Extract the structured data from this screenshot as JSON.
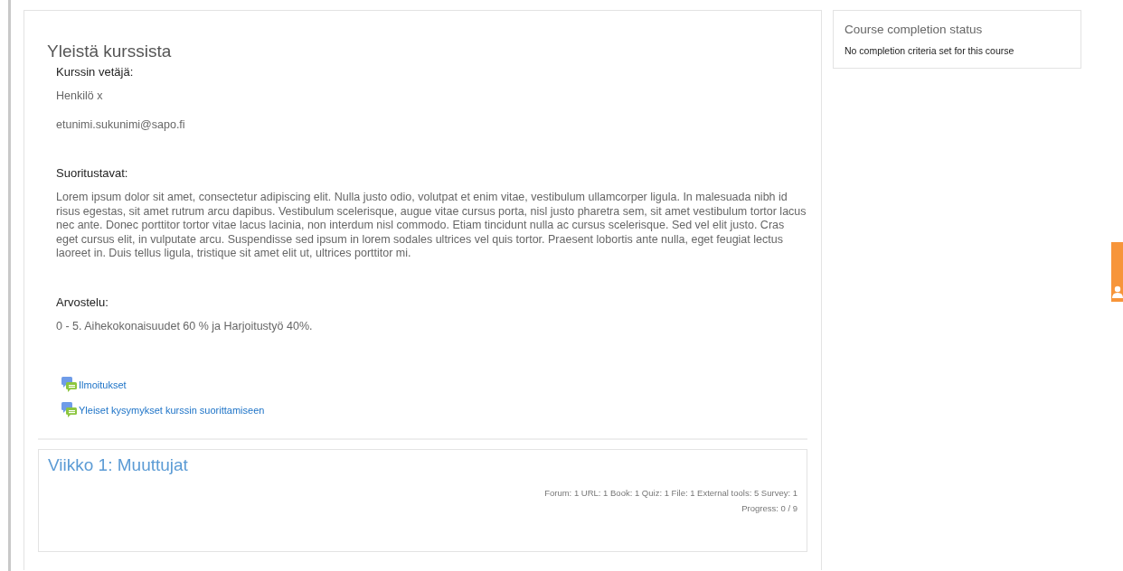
{
  "summary_section": {
    "title": "Yleistä kurssista",
    "blocks": [
      {
        "heading": "Kurssin vetäjä:",
        "paragraphs": [
          "Henkilö x",
          "etunimi.sukunimi@sapo.fi"
        ]
      },
      {
        "heading": "Suoritustavat:",
        "paragraphs": [
          "Lorem ipsum dolor sit amet, consectetur adipiscing elit. Nulla justo odio, volutpat et enim vitae, vestibulum ullamcorper ligula. In malesuada nibh id risus egestas, sit amet rutrum arcu dapibus. Vestibulum scelerisque, augue vitae cursus porta, nisl justo pharetra sem, sit amet vestibulum tortor lacus nec ante. Donec porttitor tortor vitae lacus lacinia, non interdum nisl commodo. Etiam tincidunt nulla ac cursus scelerisque. Sed vel elit justo. Cras eget cursus elit, in vulputate arcu. Suspendisse sed ipsum in lorem sodales ultrices vel quis tortor. Praesent lobortis ante nulla, eget feugiat lectus laoreet in. Duis tellus ligula, tristique sit amet elit ut, ultrices porttitor mi."
        ]
      },
      {
        "heading": "Arvostelu:",
        "paragraphs": [
          "0 - 5. Aihekokonaisuudet 60 % ja Harjoitustyö 40%."
        ]
      }
    ],
    "forums": [
      "Ilmoitukset",
      "Yleiset kysymykset kurssin suorittamiseen"
    ]
  },
  "week_section": {
    "title": "Viikko 1: Muuttujat",
    "activity_summary": "Forum: 1  URL: 1  Book: 1  Quiz: 1  File: 1  External tools: 5  Survey: 1",
    "progress": "Progress: 0 / 9"
  },
  "completion_block": {
    "title": "Course completion status",
    "message": "No completion criteria set for this course"
  }
}
